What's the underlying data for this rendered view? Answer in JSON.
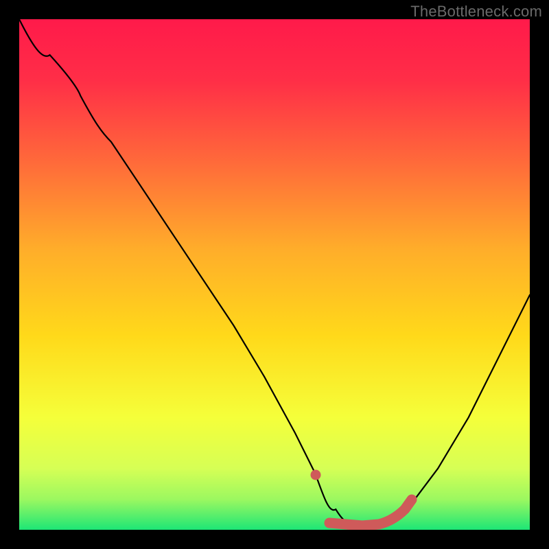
{
  "attribution": "TheBottleneck.com",
  "colors": {
    "background": "#000000",
    "gradient_top": "#ff1a4a",
    "gradient_mid": "#ffd000",
    "gradient_low": "#f7ff6e",
    "gradient_bottom": "#1de676",
    "curve": "#000000",
    "marker": "#cf5a5a"
  },
  "chart_data": {
    "type": "line",
    "title": "",
    "xlabel": "",
    "ylabel": "",
    "xlim": [
      0,
      100
    ],
    "ylim": [
      0,
      100
    ],
    "annotations": [],
    "series": [
      {
        "name": "bottleneck-curve",
        "x": [
          0,
          6,
          12,
          18,
          24,
          30,
          36,
          42,
          48,
          54,
          58,
          62,
          66,
          70,
          76,
          82,
          88,
          94,
          100
        ],
        "values": [
          100,
          93,
          85,
          76,
          67,
          58,
          49,
          40,
          30,
          19,
          11,
          4,
          1,
          1,
          4,
          12,
          22,
          34,
          46
        ]
      }
    ],
    "markers": [
      {
        "name": "flat-highlight-left-dot",
        "x": 58,
        "y": 10
      },
      {
        "name": "flat-highlight-segment",
        "x_range": [
          60,
          72
        ],
        "y": 1
      }
    ]
  }
}
